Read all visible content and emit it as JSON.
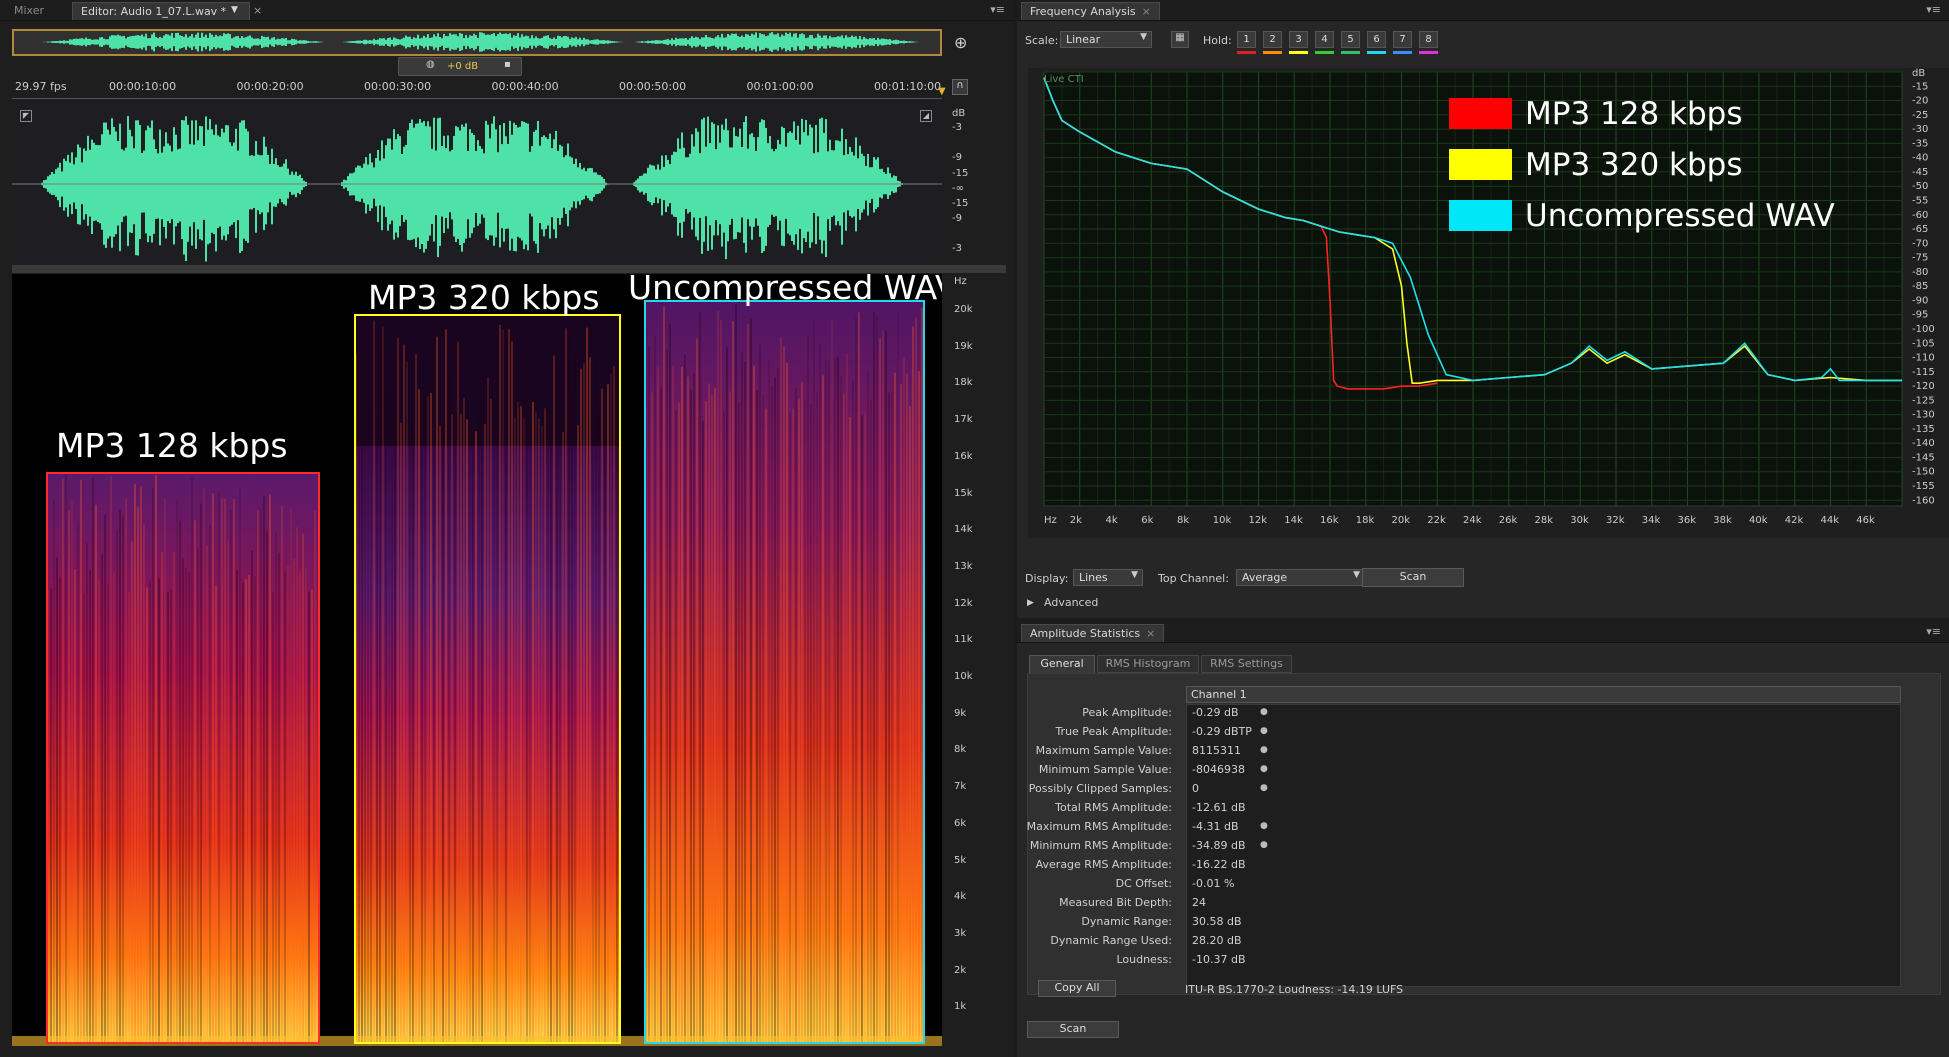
{
  "editor": {
    "tabs": [
      {
        "label": "Mixer"
      },
      {
        "label": "Editor: Audio 1_07.L.wav *"
      }
    ],
    "fps": "29.97 fps",
    "timecodes": [
      "00:00:10:00",
      "00:00:20:00",
      "00:00:30:00",
      "00:00:40:00",
      "00:00:50:00",
      "00:01:00:00",
      "00:01:10:00"
    ],
    "gain": "+0 dB",
    "db_scale": [
      "dB",
      "-3",
      "-9",
      "-15",
      "-∞",
      "-15",
      "-9",
      "-3"
    ],
    "hz_scale": [
      "Hz",
      "20k",
      "19k",
      "18k",
      "17k",
      "16k",
      "15k",
      "14k",
      "13k",
      "12k",
      "11k",
      "10k",
      "9k",
      "8k",
      "7k",
      "6k",
      "5k",
      "4k",
      "3k",
      "2k",
      "1k"
    ],
    "regions": [
      {
        "label": "MP3 128 kbps",
        "color": "#ff2a2a"
      },
      {
        "label": "MP3 320 kbps",
        "color": "#ffff1e"
      },
      {
        "label": "Uncompressed WAV",
        "color": "#22d8f0"
      }
    ]
  },
  "freq": {
    "title": "Frequency Analysis",
    "scale_label": "Scale:",
    "scale_value": "Linear",
    "hold_label": "Hold:",
    "hold_buttons": [
      {
        "label": "1",
        "color": "#e02020"
      },
      {
        "label": "2",
        "color": "#ff8a00"
      },
      {
        "label": "3",
        "color": "#ffff20"
      },
      {
        "label": "4",
        "color": "#30d030"
      },
      {
        "label": "5",
        "color": "#30c070"
      },
      {
        "label": "6",
        "color": "#20d8f0"
      },
      {
        "label": "7",
        "color": "#3a8cff"
      },
      {
        "label": "8",
        "color": "#e030e0"
      }
    ],
    "live_cti": "Live CTI",
    "legend": [
      {
        "label": "MP3 128 kbps",
        "color": "#ff0000"
      },
      {
        "label": "MP3 320 kbps",
        "color": "#ffff00"
      },
      {
        "label": "Uncompressed WAV",
        "color": "#00e8f8"
      }
    ],
    "db_axis": [
      "dB",
      "-15",
      "-20",
      "-25",
      "-30",
      "-35",
      "-40",
      "-45",
      "-50",
      "-55",
      "-60",
      "-65",
      "-70",
      "-75",
      "-80",
      "-85",
      "-90",
      "-95",
      "-100",
      "-105",
      "-110",
      "-115",
      "-120",
      "-125",
      "-130",
      "-135",
      "-140",
      "-145",
      "-150",
      "-155",
      "-160"
    ],
    "hz_axis": [
      "Hz",
      "2k",
      "4k",
      "6k",
      "8k",
      "10k",
      "12k",
      "14k",
      "16k",
      "18k",
      "20k",
      "22k",
      "24k",
      "26k",
      "28k",
      "30k",
      "32k",
      "34k",
      "36k",
      "38k",
      "40k",
      "42k",
      "44k",
      "46k"
    ],
    "display_label": "Display:",
    "display_value": "Lines",
    "top_channel_label": "Top Channel:",
    "top_channel_value": "Average",
    "scan_label": "Scan",
    "advanced_label": "Advanced"
  },
  "chart_data": {
    "type": "line",
    "xlabel": "Hz",
    "ylabel": "dB",
    "xlim": [
      0,
      48000
    ],
    "ylim": [
      -162,
      -10
    ],
    "series": [
      {
        "name": "MP3 128 kbps",
        "color": "#ff2020",
        "x": [
          0,
          500,
          1000,
          2000,
          4000,
          6000,
          8000,
          10000,
          12000,
          13500,
          14500,
          15500,
          15800,
          16000,
          16200,
          16400,
          17000,
          18000,
          19000,
          20000,
          21000,
          22000
        ],
        "y": [
          -12,
          -20,
          -27,
          -31,
          -38,
          -42,
          -44,
          -52,
          -58,
          -61,
          -62,
          -64,
          -68,
          -90,
          -118,
          -120,
          -121,
          -121,
          -121,
          -120,
          -120,
          -119
        ]
      },
      {
        "name": "MP3 320 kbps",
        "color": "#ffff20",
        "x": [
          0,
          500,
          1000,
          2000,
          4000,
          6000,
          8000,
          10000,
          12000,
          13500,
          14500,
          15500,
          16500,
          17500,
          18500,
          19500,
          20000,
          20300,
          20600,
          21000,
          22000,
          24000,
          26000,
          28000,
          29500,
          30500,
          31500,
          32500,
          34000,
          36000,
          38000,
          39200,
          40500,
          42000,
          44000,
          46000,
          48000
        ],
        "y": [
          -12,
          -20,
          -27,
          -31,
          -38,
          -42,
          -44,
          -52,
          -58,
          -61,
          -62,
          -64,
          -66,
          -67,
          -68,
          -72,
          -85,
          -105,
          -119,
          -119,
          -118,
          -118,
          -117,
          -116,
          -112,
          -107,
          -112,
          -109,
          -114,
          -113,
          -112,
          -106,
          -116,
          -118,
          -117,
          -118,
          -118
        ]
      },
      {
        "name": "Uncompressed WAV",
        "color": "#20e0f0",
        "x": [
          0,
          500,
          1000,
          2000,
          4000,
          6000,
          8000,
          10000,
          12000,
          13500,
          14500,
          15500,
          16500,
          17500,
          18500,
          19500,
          20500,
          21500,
          22500,
          24000,
          26000,
          28000,
          29500,
          30500,
          31500,
          32500,
          34000,
          36000,
          38000,
          39200,
          40500,
          42000,
          43500,
          44000,
          44500,
          46000,
          48000
        ],
        "y": [
          -12,
          -20,
          -27,
          -31,
          -38,
          -42,
          -44,
          -52,
          -58,
          -61,
          -62,
          -64,
          -66,
          -67,
          -68,
          -70,
          -82,
          -102,
          -116,
          -118,
          -117,
          -116,
          -112,
          -106,
          -111,
          -108,
          -114,
          -113,
          -112,
          -105,
          -116,
          -118,
          -117,
          -114,
          -118,
          -118,
          -118
        ]
      }
    ]
  },
  "stats": {
    "title": "Amplitude Statistics",
    "tabs": [
      {
        "label": "General"
      },
      {
        "label": "RMS Histogram"
      },
      {
        "label": "RMS Settings"
      }
    ],
    "channel_header": "Channel 1",
    "rows": [
      {
        "name": "Peak Amplitude:",
        "value": "-0.29 dB"
      },
      {
        "name": "True Peak Amplitude:",
        "value": "-0.29 dBTP"
      },
      {
        "name": "Maximum Sample Value:",
        "value": "8115311"
      },
      {
        "name": "Minimum Sample Value:",
        "value": "-8046938"
      },
      {
        "name": "Possibly Clipped Samples:",
        "value": "0"
      },
      {
        "name": "Total RMS Amplitude:",
        "value": "-12.61 dB"
      },
      {
        "name": "Maximum RMS Amplitude:",
        "value": "-4.31 dB"
      },
      {
        "name": "Minimum RMS Amplitude:",
        "value": "-34.89 dB"
      },
      {
        "name": "Average RMS Amplitude:",
        "value": "-16.22 dB"
      },
      {
        "name": "DC Offset:",
        "value": "-0.01 %"
      },
      {
        "name": "Measured Bit Depth:",
        "value": "24"
      },
      {
        "name": "Dynamic Range:",
        "value": "30.58 dB"
      },
      {
        "name": "Dynamic Range Used:",
        "value": "28.20 dB"
      },
      {
        "name": "Loudness:",
        "value": "-10.37 dB"
      }
    ],
    "copy_all_label": "Copy All",
    "itu_loudness": "ITU-R BS.1770-2 Loudness: -14.19 LUFS",
    "scan_label": "Scan"
  }
}
